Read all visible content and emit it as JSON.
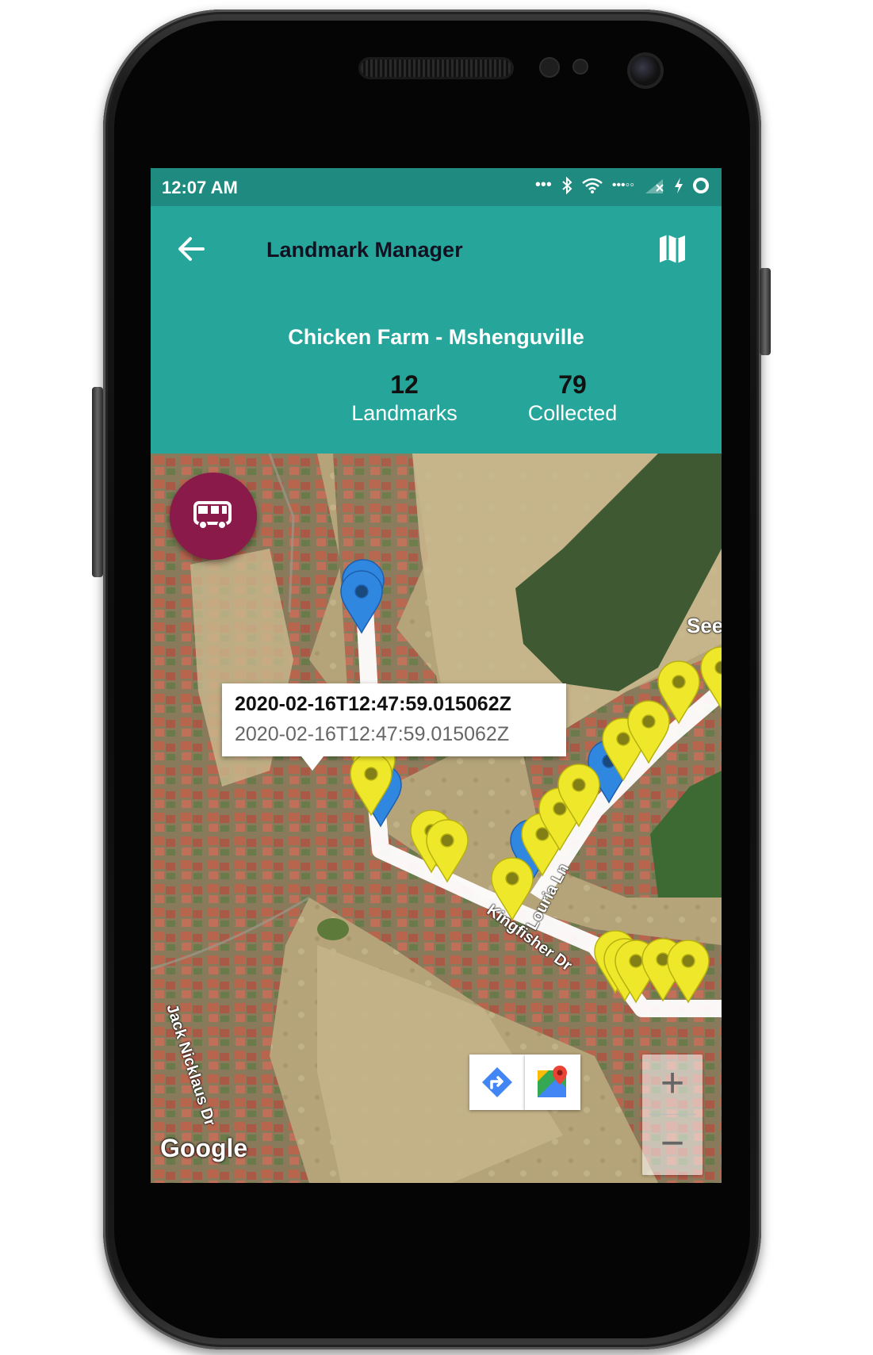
{
  "status_bar": {
    "time": "12:07 AM"
  },
  "app_bar": {
    "title": "Landmark Manager",
    "back_icon": "arrow-left-icon",
    "map_icon": "map-icon"
  },
  "header": {
    "farm_name": "Chicken Farm - Mshenguville",
    "stats": [
      {
        "value": "12",
        "label": "Landmarks"
      },
      {
        "value": "79",
        "label": "Collected"
      }
    ]
  },
  "map": {
    "fab_icon": "bus-icon",
    "fab_color": "#8a1a4a",
    "info_window": {
      "title": "2020-02-16T12:47:59.015062Z",
      "subtitle": "2020-02-16T12:47:59.015062Z"
    },
    "street_labels": [
      "Kingfisher Dr",
      "Louria Ln",
      "Jack Nicklaus Dr",
      "See"
    ],
    "attribution": "Google",
    "zoom_in": "+",
    "zoom_out": "−",
    "marker_colors": {
      "collected": "#f0ea2a",
      "landmark": "#2f87e0"
    }
  },
  "colors": {
    "primary": "#26a69a",
    "primary_dark": "#1f8a80",
    "accent": "#8a1a4a"
  }
}
